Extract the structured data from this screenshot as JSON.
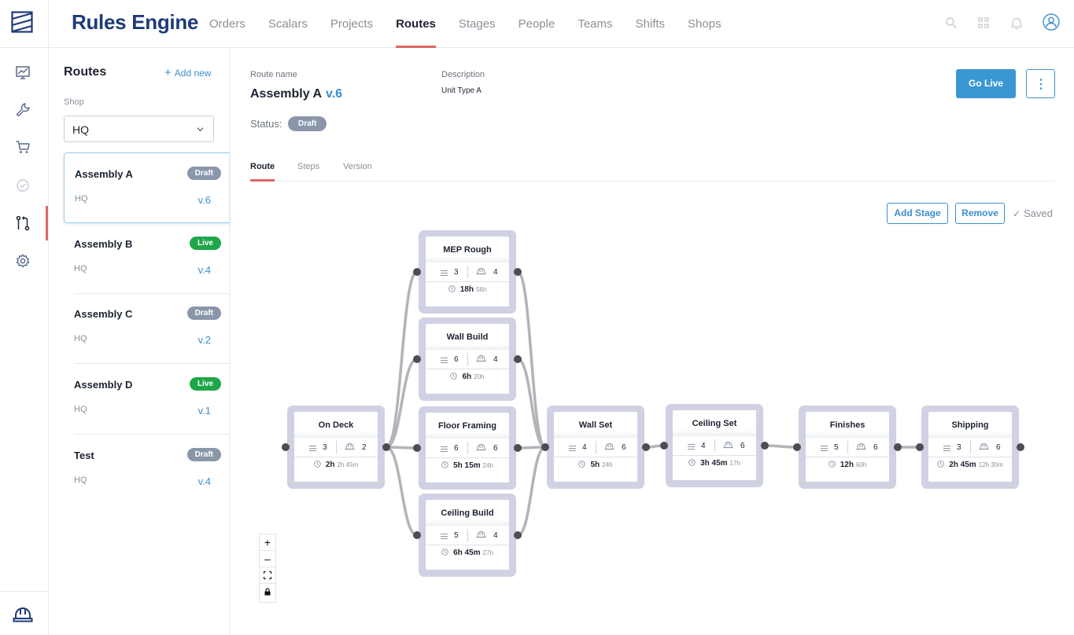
{
  "app": {
    "title": "Rules Engine"
  },
  "nav": [
    "Orders",
    "Scalars",
    "Projects",
    "Routes",
    "Stages",
    "People",
    "Teams",
    "Shifts",
    "Shops"
  ],
  "nav_active": "Routes",
  "rail_icons": [
    "dashboard-icon",
    "wrench-icon",
    "cart-icon",
    "check-circle-icon",
    "routes-icon",
    "settings-icon",
    "hardhat-icon"
  ],
  "sidebar": {
    "title": "Routes",
    "add_new": "Add new",
    "shop_label": "Shop",
    "shop_value": "HQ",
    "routes": [
      {
        "name": "Assembly A",
        "status": "Draft",
        "shop": "HQ",
        "version": "v.6",
        "selected": true
      },
      {
        "name": "Assembly B",
        "status": "Live",
        "shop": "HQ",
        "version": "v.4"
      },
      {
        "name": "Assembly C",
        "status": "Draft",
        "shop": "HQ",
        "version": "v.2"
      },
      {
        "name": "Assembly D",
        "status": "Live",
        "shop": "HQ",
        "version": "v.1"
      },
      {
        "name": "Test",
        "status": "Draft",
        "shop": "HQ",
        "version": "v.4"
      }
    ]
  },
  "detail": {
    "route_name_label": "Route name",
    "route_name": "Assembly A",
    "version": "v.6",
    "description_label": "Description",
    "description": "Unit Type A",
    "status_label": "Status:",
    "status": "Draft",
    "go_live": "Go Live",
    "tabs": [
      "Route",
      "Steps",
      "Version"
    ],
    "active_tab": "Route",
    "add_stage": "Add Stage",
    "remove": "Remove",
    "saved": "Saved"
  },
  "stages": [
    {
      "id": "on-deck",
      "name": "On Deck",
      "steps": "3",
      "crew": "2",
      "time": "2h",
      "sub": "2h 45m"
    },
    {
      "id": "mep-rough",
      "name": "MEP Rough",
      "steps": "3",
      "crew": "4",
      "time": "18h",
      "sub": "56h"
    },
    {
      "id": "wall-build",
      "name": "Wall Build",
      "steps": "6",
      "crew": "4",
      "time": "6h",
      "sub": "20h"
    },
    {
      "id": "floor-framing",
      "name": "Floor Framing",
      "steps": "6",
      "crew": "6",
      "time": "5h 15m",
      "sub": "24h"
    },
    {
      "id": "ceiling-build",
      "name": "Ceiling Build",
      "steps": "5",
      "crew": "4",
      "time": "6h 45m",
      "sub": "27h"
    },
    {
      "id": "wall-set",
      "name": "Wall Set",
      "steps": "4",
      "crew": "6",
      "time": "5h",
      "sub": "24h"
    },
    {
      "id": "ceiling-set",
      "name": "Ceiling Set",
      "steps": "4",
      "crew": "6",
      "time": "3h 45m",
      "sub": "17h"
    },
    {
      "id": "finishes",
      "name": "Finishes",
      "steps": "5",
      "crew": "6",
      "time": "12h",
      "sub": "60h"
    },
    {
      "id": "shipping",
      "name": "Shipping",
      "steps": "3",
      "crew": "6",
      "time": "2h 45m",
      "sub": "12h 30m"
    }
  ],
  "edges": [
    [
      "on-deck",
      "mep-rough"
    ],
    [
      "on-deck",
      "wall-build"
    ],
    [
      "on-deck",
      "floor-framing"
    ],
    [
      "on-deck",
      "ceiling-build"
    ],
    [
      "mep-rough",
      "wall-set"
    ],
    [
      "wall-build",
      "wall-set"
    ],
    [
      "floor-framing",
      "wall-set"
    ],
    [
      "ceiling-build",
      "wall-set"
    ],
    [
      "wall-set",
      "ceiling-set"
    ],
    [
      "ceiling-set",
      "finishes"
    ],
    [
      "finishes",
      "shipping"
    ]
  ],
  "zoom_controls": [
    "+",
    "–",
    "fit",
    "lock"
  ],
  "colors": {
    "brand": "#1e3a78",
    "accent": "#e06666",
    "link": "#3b8fd0",
    "draft": "#8a96aa",
    "live": "#1fa64a",
    "stage_border": "#d0d1e3"
  }
}
